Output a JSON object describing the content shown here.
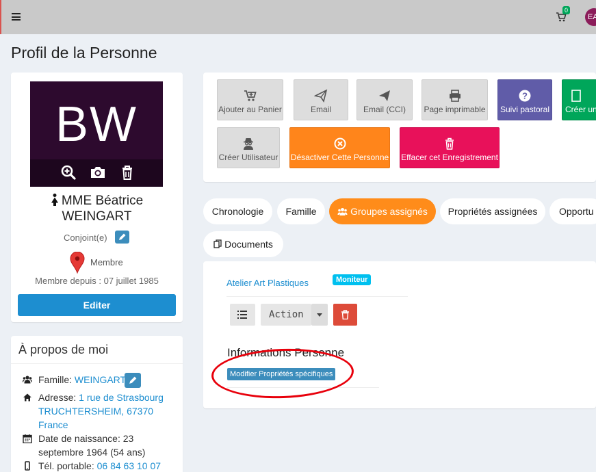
{
  "topbar": {
    "cart_count": "0",
    "avatar_initials": "EA"
  },
  "page": {
    "title": "Profil de la Personne"
  },
  "profile": {
    "initials": "BW",
    "name_line1": "MME Béatrice",
    "name_line2": "WEINGART",
    "role": "Conjoint(e)",
    "classification": "Membre",
    "member_since": "Membre depuis : 07 juillet 1985",
    "edit_label": "Editer"
  },
  "about": {
    "title": "À propos de moi",
    "family_label": "Famille:",
    "family_value": "WEINGART",
    "address_label": "Adresse:",
    "address_line1": "1 rue de Strasbourg",
    "address_line2": "TRUCHTERSHEIM, 67370",
    "address_line3": "France",
    "birth_label": "Date de naissance: 23",
    "birth_line2": "septembre 1964 (54 ans)",
    "mobile_label": "Tél. portable:",
    "mobile_value": "06 84 63 10 07"
  },
  "actions": {
    "add_cart": "Ajouter au Panier",
    "email": "Email",
    "email_cc": "Email (CCI)",
    "print": "Page imprimable",
    "pastoral": "Suivi pastoral",
    "create": "Créer un",
    "create_user": "Créer Utilisateur",
    "deactivate": "Désactiver Cette Personne",
    "delete": "Effacer cet Enregistrement"
  },
  "tabs": {
    "timeline": "Chronologie",
    "family": "Famille",
    "groups": "Groupes assignés",
    "properties": "Propriétés assignées",
    "opportunities": "Opportu",
    "documents": "Documents"
  },
  "groups": {
    "group_name": "Atelier Art Plastiques",
    "group_role": "Moniteur",
    "action_label": "Action",
    "info_title": "Informations Personne",
    "props_button": "Modifier Propriétés spécifiques"
  },
  "colors": {
    "accent_orange": "#ff8c1a",
    "link_blue": "#1d8ed0",
    "annotation_red": "#e8000b"
  }
}
